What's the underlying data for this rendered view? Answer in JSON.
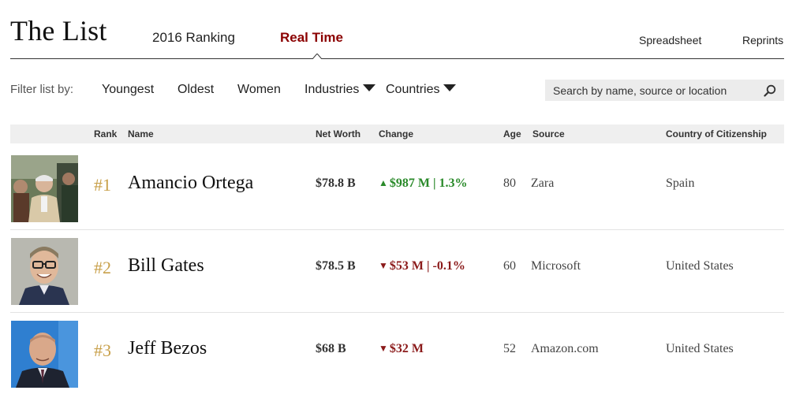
{
  "header": {
    "title": "The List",
    "tabs": [
      {
        "label": "2016 Ranking"
      },
      {
        "label": "Real Time",
        "active": true
      }
    ],
    "links": {
      "spreadsheet": "Spreadsheet",
      "reprints": "Reprints"
    }
  },
  "filters": {
    "label": "Filter list by:",
    "items": [
      "Youngest",
      "Oldest",
      "Women",
      "Industries",
      "Countries"
    ]
  },
  "search": {
    "placeholder": "Search by name, source or location",
    "icon": "search-icon"
  },
  "table": {
    "columns": [
      "Rank",
      "Name",
      "Net Worth",
      "Change",
      "Age",
      "Source",
      "Country of Citizenship"
    ],
    "rows": [
      {
        "rank": "#1",
        "name": "Amancio Ortega",
        "net_worth": "$78.8 B",
        "change": "$987 M | 1.3%",
        "direction": "up",
        "age": "80",
        "source": "Zara",
        "country": "Spain"
      },
      {
        "rank": "#2",
        "name": "Bill Gates",
        "net_worth": "$78.5 B",
        "change": "$53 M | -0.1%",
        "direction": "down",
        "age": "60",
        "source": "Microsoft",
        "country": "United States"
      },
      {
        "rank": "#3",
        "name": "Jeff Bezos",
        "net_worth": "$68 B",
        "change": "$32 M",
        "direction": "down",
        "age": "52",
        "source": "Amazon.com",
        "country": "United States"
      }
    ]
  },
  "colors": {
    "accent_red": "#8b0000",
    "rank_gold": "#c8a04a",
    "change_up": "#2a8a2a",
    "change_down": "#8b1a1a"
  }
}
